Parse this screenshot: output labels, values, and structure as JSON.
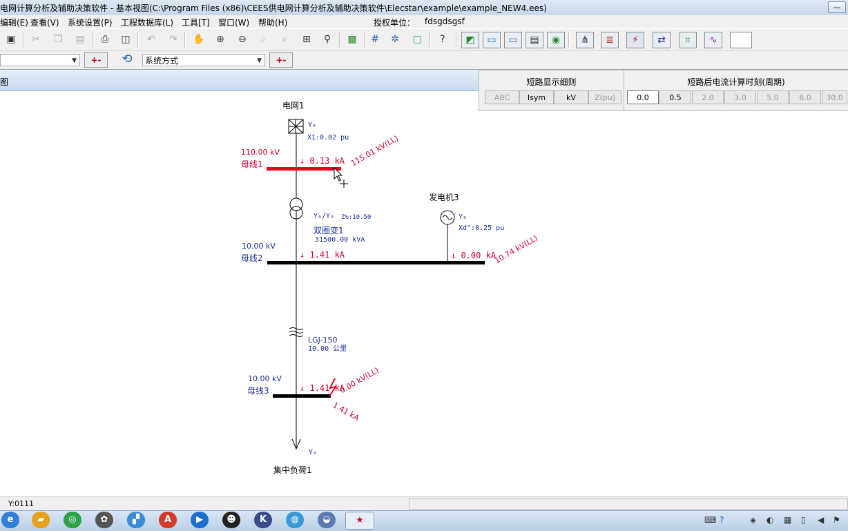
{
  "window": {
    "title": "电网计算分析及辅助决策软件 - 基本视图(C:\\Program Files (x86)\\CEES供电网计算分析及辅助决策软件\\Elecstar\\example\\example_NEW4.ees)",
    "minimize": "—",
    "maximize": "□"
  },
  "menu": {
    "items": [
      "编辑(E)",
      "查看(V)",
      "系统设置(P)",
      "工程数据库(L)",
      "工具[T]",
      "窗口(W)",
      "帮助(H)"
    ],
    "license_label": "授权单位：",
    "license_value": "fdsgdsgsf"
  },
  "toolbar2": {
    "mode_combo": "系统方式",
    "plusminus": "+-"
  },
  "view": {
    "label": "图"
  },
  "short_circuit": {
    "detail_title": "短路显示细则",
    "detail_buttons": [
      "ABC",
      "Isym",
      "kV",
      "Z(pu)"
    ],
    "time_title": "短路后电流计算时刻(周期)",
    "time_buttons": [
      "0.0",
      "0.5",
      "2.0",
      "3.0",
      "5.0",
      "8.0",
      "30.0"
    ],
    "selected_time": "0.0",
    "highlight_time": "0.5"
  },
  "diagram": {
    "grid": {
      "name": "电网1",
      "param": "X1:0.02  pu",
      "winding": "Y₀"
    },
    "bus1": {
      "kv": "110.00 kV",
      "name": "母线1",
      "current": "↓ 0.13  kA",
      "voltage": "115.01 kV(LL)"
    },
    "transformer": {
      "name": "双圈变1",
      "rating": "31500.00 kVA",
      "conn": "Y₀/Y₀",
      "z": "Z%:10.50"
    },
    "generator": {
      "name": "发电机3",
      "param": "Xd\":0.25  pu",
      "winding": "Y₀"
    },
    "bus2": {
      "kv": "10.00 kV",
      "name": "母线2",
      "current": "↓ 1.41  kA",
      "gen_current": "↓ 0.00  kA",
      "voltage": "10.74 kV(LL)"
    },
    "line": {
      "type": "LGJ-150",
      "length": "10.00  公里"
    },
    "bus3": {
      "kv": "10.00 kV",
      "name": "母线3",
      "current": "↓ 1.41  kA",
      "voltage": "0.00 kV(LL)",
      "fault_current": "1.41 kA"
    },
    "load": {
      "name": "集中负荷1",
      "winding": "Y₀"
    }
  },
  "status": {
    "coord": "Y:0111"
  },
  "taskbar": {
    "apps": [
      "ie-icon",
      "folder-icon",
      "browser-icon",
      "app-icon",
      "paint-icon",
      "acrobat-icon",
      "media-icon",
      "qq-icon",
      "k-icon",
      "network-icon",
      "app2-icon",
      "elecstar-icon"
    ]
  }
}
